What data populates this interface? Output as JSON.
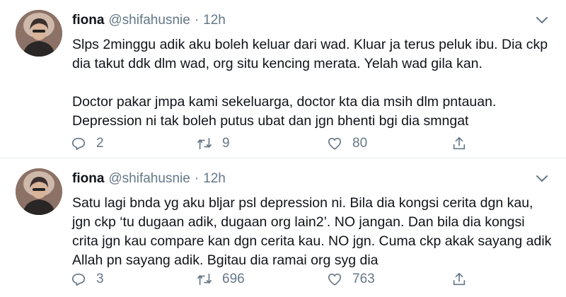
{
  "tweets": [
    {
      "name": "fiona",
      "handle": "@shifahusnie",
      "separator": "·",
      "time": "12h",
      "paragraphs": [
        "Slps 2minggu adik aku boleh keluar dari wad. Kluar ja terus peluk ibu. Dia ckp dia takut ddk dlm wad, org situ kencing merata. Yelah wad gila kan.",
        "Doctor pakar jmpa kami sekeluarga, doctor kta dia msih dlm pntauan. Depression ni tak boleh putus ubat dan jgn bhenti bgi dia smngat"
      ],
      "replies": "2",
      "retweets": "9",
      "likes": "80"
    },
    {
      "name": "fiona",
      "handle": "@shifahusnie",
      "separator": "·",
      "time": "12h",
      "paragraphs": [
        "Satu lagi bnda yg aku bljar psl depression ni. Bila dia kongsi cerita dgn kau, jgn ckp ‘tu dugaan adik, dugaan org lain2’. NO jangan. Dan bila dia kongsi crita jgn kau compare kan dgn cerita kau. NO jgn. Cuma ckp akak sayang adik Allah pn sayang adik. Bgitau dia ramai org syg dia"
      ],
      "replies": "3",
      "retweets": "696",
      "likes": "763"
    }
  ],
  "icons": {
    "reply": "reply-icon",
    "retweet": "retweet-icon",
    "like": "like-icon",
    "share": "share-icon",
    "more": "chevron-down-icon"
  },
  "colors": {
    "text": "#0f1419",
    "muted": "#657786",
    "divider": "#e6ecf0"
  }
}
